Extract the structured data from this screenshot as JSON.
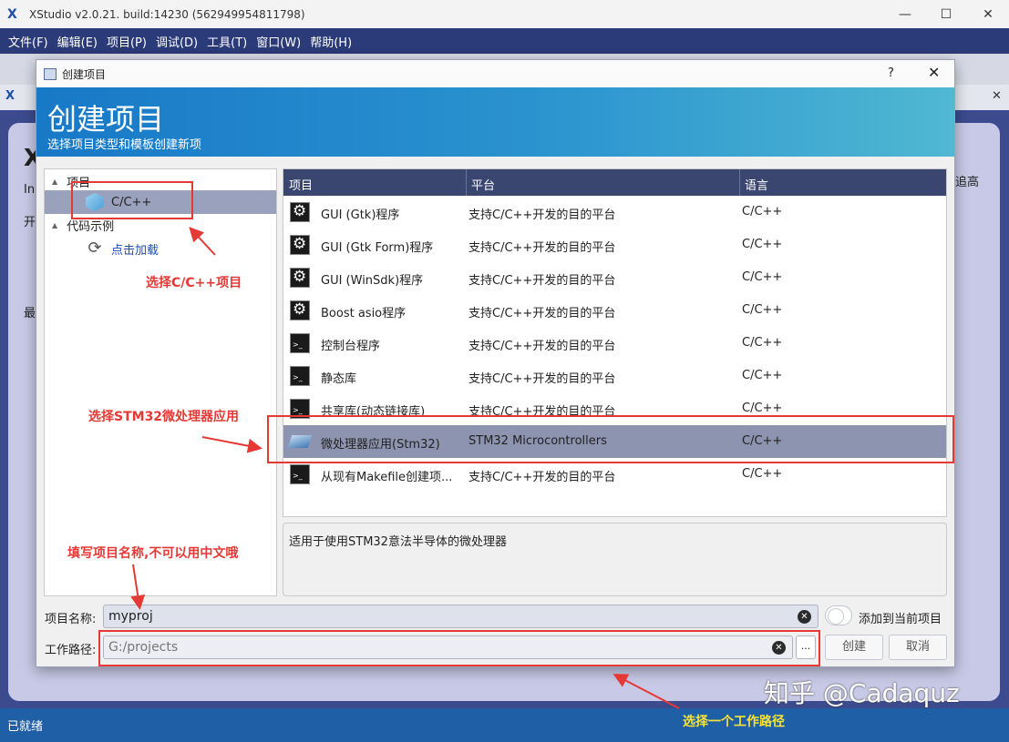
{
  "window": {
    "title": "XStudio v2.0.21. build:14230 (562949954811798)",
    "app_icon": "X",
    "minimize": "—",
    "maximize": "☐",
    "close": "✕"
  },
  "menubar": {
    "items": [
      "文件(F)",
      "编辑(E)",
      "项目(P)",
      "调试(D)",
      "工具(T)",
      "窗口(W)",
      "帮助(H)"
    ]
  },
  "doc_tab": {
    "icon": "X",
    "close": "✕"
  },
  "workspace": {
    "fragments": [
      "X",
      "In",
      "开",
      "最",
      "追高"
    ]
  },
  "statusbar": {
    "text": "已就绪"
  },
  "dialog": {
    "title": "创建项目",
    "help": "?",
    "close": "✕",
    "banner_title": "创建项目",
    "banner_subtitle": "选择项目类型和模板创建新项",
    "tree": {
      "group_project": "项目",
      "item_cpp": "C/C++",
      "group_samples": "代码示例",
      "item_load": "点击加载"
    },
    "list": {
      "headers": [
        "项目",
        "平台",
        "语言"
      ],
      "rows": [
        {
          "icon": "gear-icon",
          "name": "GUI (Gtk)程序",
          "platform": "支持C/C++开发的目的平台",
          "lang": "C/C++"
        },
        {
          "icon": "gear-icon",
          "name": "GUI (Gtk Form)程序",
          "platform": "支持C/C++开发的目的平台",
          "lang": "C/C++"
        },
        {
          "icon": "gear-icon",
          "name": "GUI (WinSdk)程序",
          "platform": "支持C/C++开发的目的平台",
          "lang": "C/C++"
        },
        {
          "icon": "gear-icon",
          "name": "Boost asio程序",
          "platform": "支持C/C++开发的目的平台",
          "lang": "C/C++"
        },
        {
          "icon": "console-icon",
          "name": "控制台程序",
          "platform": "支持C/C++开发的目的平台",
          "lang": "C/C++"
        },
        {
          "icon": "console-icon",
          "name": "静态库",
          "platform": "支持C/C++开发的目的平台",
          "lang": "C/C++"
        },
        {
          "icon": "console-icon",
          "name": "共享库(动态链接库)",
          "platform": "支持C/C++开发的目的平台",
          "lang": "C/C++"
        },
        {
          "icon": "chip-icon",
          "name": "微处理器应用(Stm32)",
          "platform": "STM32 Microcontrollers",
          "lang": "C/C++"
        },
        {
          "icon": "console-icon",
          "name": "从现有Makefile创建项...",
          "platform": "支持C/C++开发的目的平台",
          "lang": "C/C++"
        }
      ],
      "selected_index": 7
    },
    "description": "适用于使用STM32意法半导体的微处理器",
    "form": {
      "name_label": "项目名称:",
      "name_value": "myproj",
      "add_label": "添加到当前项目",
      "path_label": "工作路径:",
      "path_placeholder": "G:/projects",
      "browse": "...",
      "create": "创建",
      "cancel": "取消"
    }
  },
  "annotations": {
    "select_cpp": "选择C/C++项目",
    "select_stm32": "选择STM32微处理器应用",
    "fill_name": "填写项目名称,不可以用中文哦",
    "select_path": "选择一个工作路径",
    "watermark": "知乎 @Cadaquz",
    "colors": {
      "annotation": "#e53935",
      "annotation_yellow": "#f7e23a"
    }
  }
}
